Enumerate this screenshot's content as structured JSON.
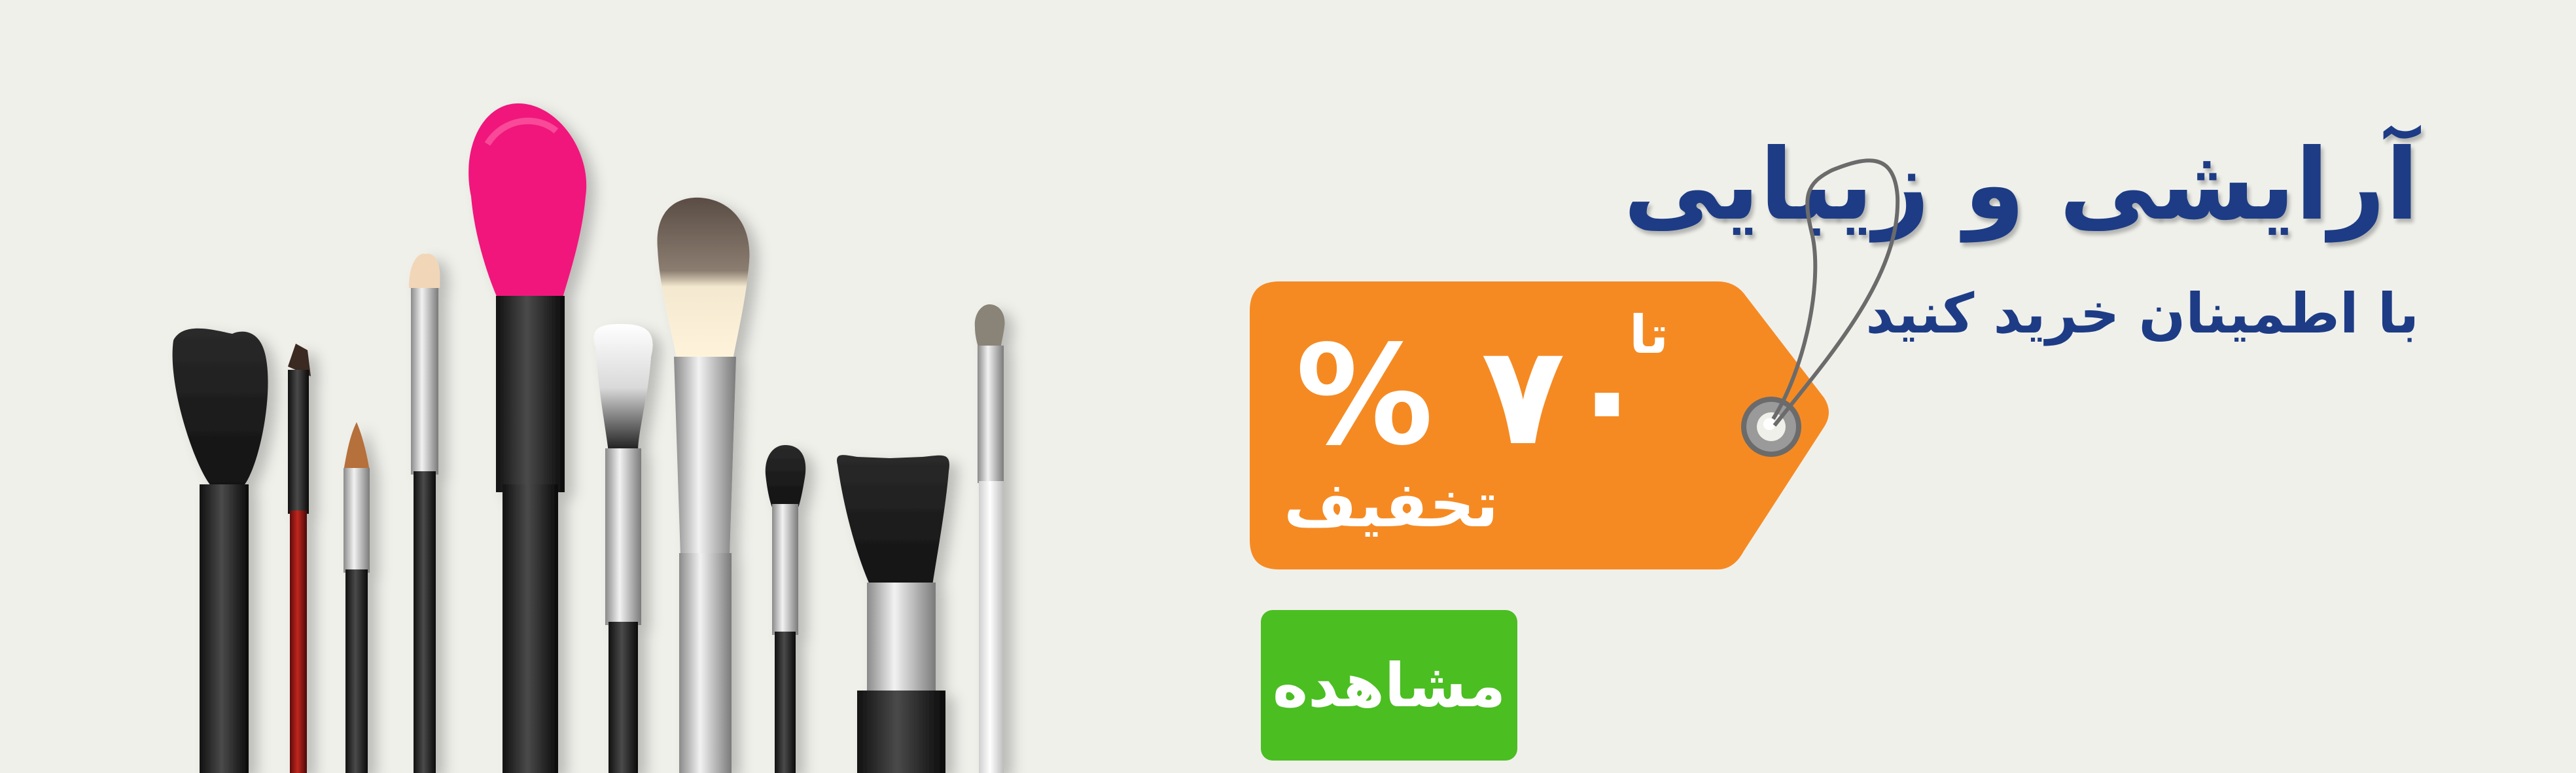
{
  "banner": {
    "title": "آرایشی و زیبایی",
    "subtitle": "با اطمینان خرید کنید",
    "tag": {
      "prefix": "تا",
      "percent": "۷۰ %",
      "label": "تخفیف"
    },
    "button_label": "مشاهده"
  },
  "colors": {
    "background": "#f0f0eb",
    "title": "#1d3c85",
    "tag": "#f58a23",
    "button": "#4bbe22"
  },
  "icons": [
    "makeup-brushes-image",
    "price-tag-icon"
  ]
}
